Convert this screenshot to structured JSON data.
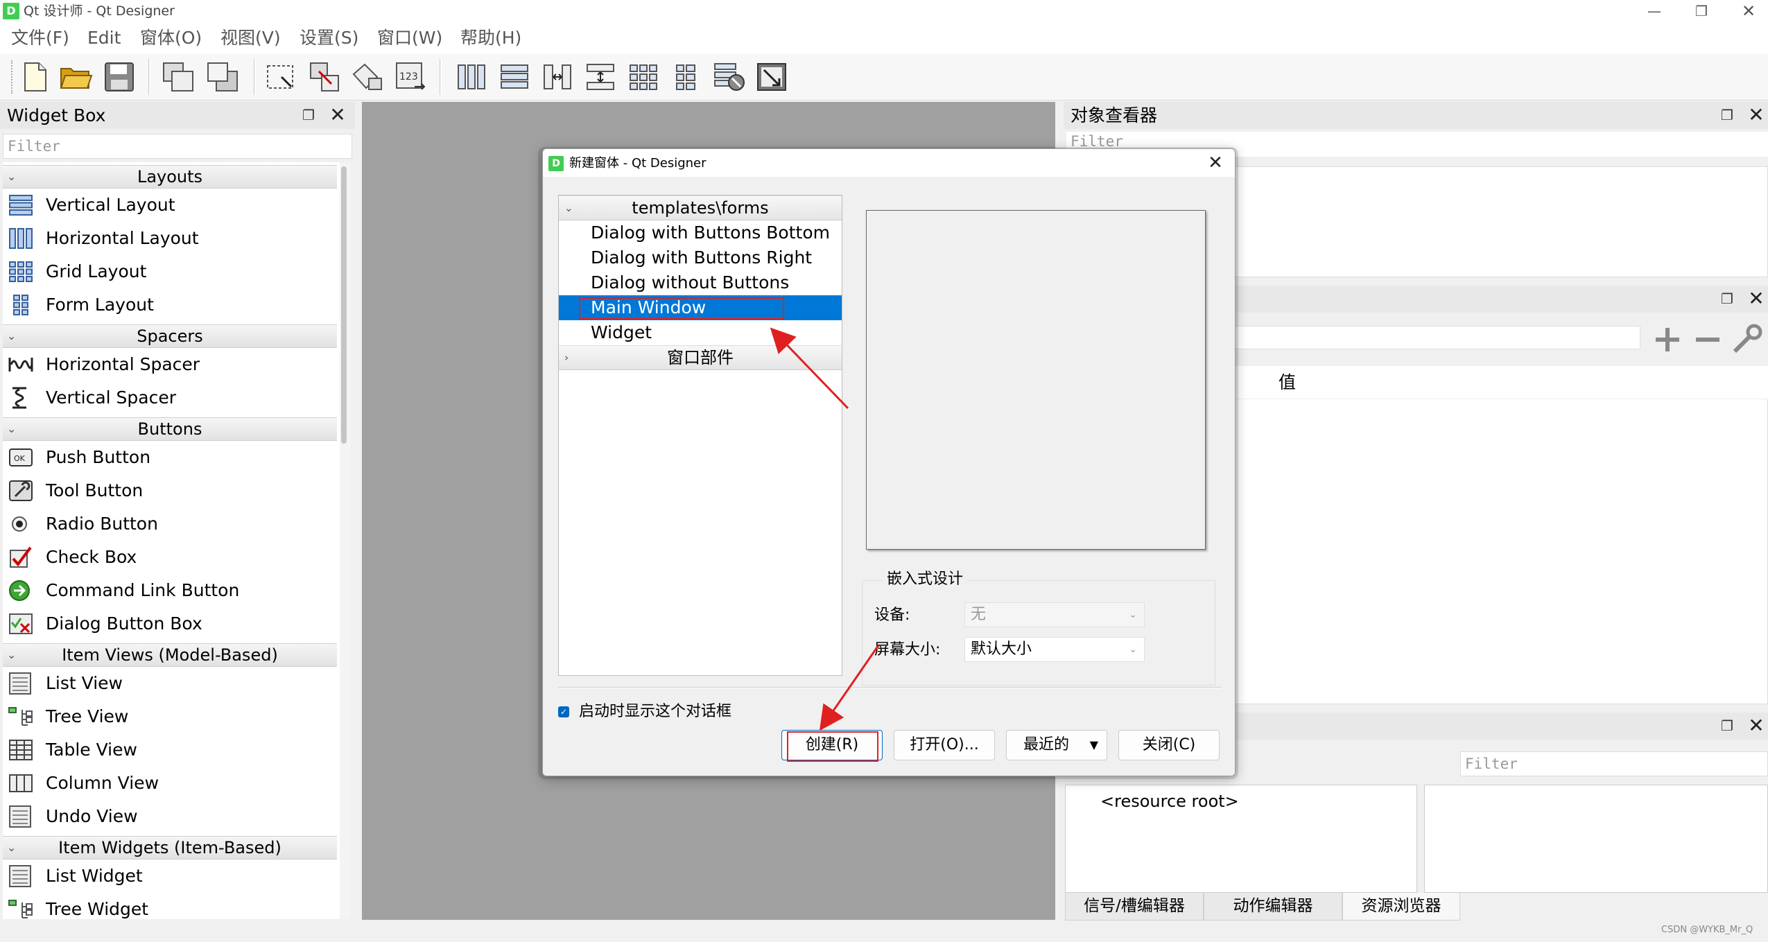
{
  "window": {
    "title": "Qt 设计师 - Qt Designer",
    "app_icon": "D"
  },
  "menu": [
    "文件(F)",
    "Edit",
    "窗体(O)",
    "视图(V)",
    "设置(S)",
    "窗口(W)",
    "帮助(H)"
  ],
  "widget_box": {
    "title": "Widget Box",
    "filter_placeholder": "Filter",
    "categories": [
      {
        "name": "Layouts",
        "items": [
          "Vertical Layout",
          "Horizontal Layout",
          "Grid Layout",
          "Form Layout"
        ]
      },
      {
        "name": "Spacers",
        "items": [
          "Horizontal Spacer",
          "Vertical Spacer"
        ]
      },
      {
        "name": "Buttons",
        "items": [
          "Push Button",
          "Tool Button",
          "Radio Button",
          "Check Box",
          "Command Link Button",
          "Dialog Button Box"
        ]
      },
      {
        "name": "Item Views (Model-Based)",
        "items": [
          "List View",
          "Tree View",
          "Table View",
          "Column View",
          "Undo View"
        ]
      },
      {
        "name": "Item Widgets (Item-Based)",
        "items": [
          "List Widget",
          "Tree Widget"
        ]
      }
    ]
  },
  "object_inspector": {
    "title": "对象查看器",
    "filter_placeholder": "Filter"
  },
  "property_editor": {
    "value_header": "值"
  },
  "resource_browser": {
    "filter_placeholder": "Filter",
    "root": "<resource root>"
  },
  "bottom_tabs": [
    "信号/槽编辑器",
    "动作编辑器",
    "资源浏览器"
  ],
  "dialog": {
    "title": "新建窗体 - Qt Designer",
    "template_category": "templates\\forms",
    "templates": [
      "Dialog with Buttons Bottom",
      "Dialog with Buttons Right",
      "Dialog without Buttons",
      "Main Window",
      "Widget"
    ],
    "selected_template": "Main Window",
    "widgets_category": "窗口部件",
    "embedded_title": "嵌入式设计",
    "device_label": "设备:",
    "device_value": "无",
    "screen_size_label": "屏幕大小:",
    "screen_size_value": "默认大小",
    "show_on_startup_label": "启动时显示这个对话框",
    "show_on_startup": true,
    "buttons": {
      "create": "创建(R)",
      "open": "打开(O)...",
      "recent": "最近的",
      "close": "关闭(C)"
    }
  },
  "watermark": "CSDN @WYKB_Mr_Q"
}
